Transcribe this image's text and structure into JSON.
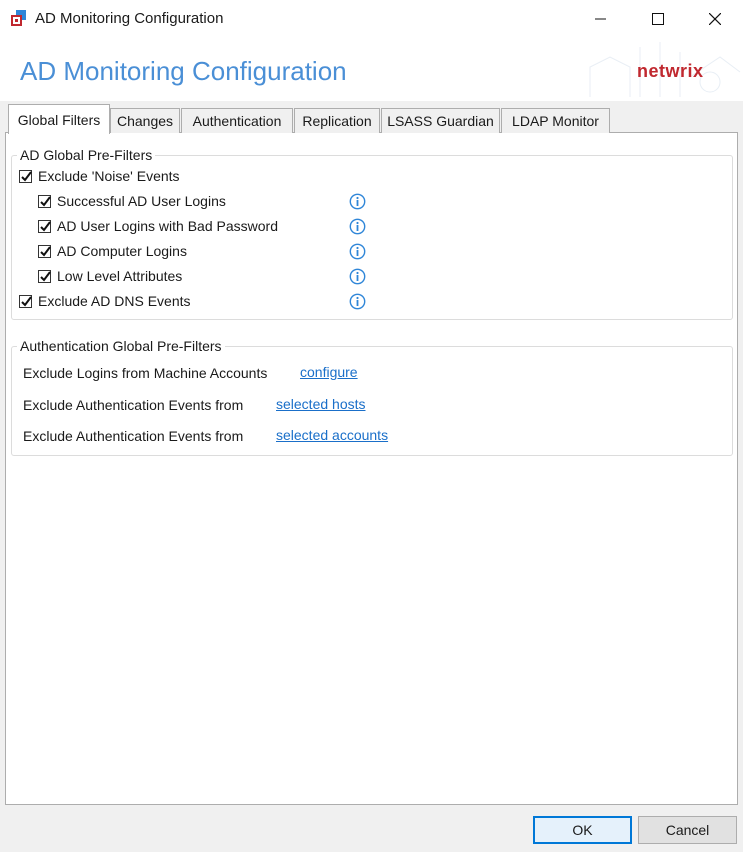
{
  "window": {
    "title": "AD Monitoring Configuration"
  },
  "banner": {
    "title": "AD Monitoring Configuration",
    "brand": "netwrix"
  },
  "tabs": [
    {
      "label": "Global Filters",
      "active": true
    },
    {
      "label": "Changes",
      "active": false
    },
    {
      "label": "Authentication",
      "active": false
    },
    {
      "label": "Replication",
      "active": false
    },
    {
      "label": "LSASS Guardian",
      "active": false
    },
    {
      "label": "LDAP Monitor",
      "active": false
    }
  ],
  "ad_prefilters": {
    "legend": "AD Global Pre-Filters",
    "items": [
      {
        "label": "Exclude 'Noise' Events",
        "checked": true,
        "info": false
      },
      {
        "label": "Successful AD User Logins",
        "checked": true,
        "info": true
      },
      {
        "label": "AD User Logins with Bad Password",
        "checked": true,
        "info": true
      },
      {
        "label": "AD Computer Logins",
        "checked": true,
        "info": true
      },
      {
        "label": "Low Level Attributes",
        "checked": true,
        "info": true
      },
      {
        "label": "Exclude AD DNS Events",
        "checked": true,
        "info": true
      }
    ]
  },
  "auth_prefilters": {
    "legend": "Authentication Global Pre-Filters",
    "rows": [
      {
        "label": "Exclude Logins from Machine Accounts",
        "link": "configure"
      },
      {
        "label": "Exclude Authentication Events from",
        "link": "selected hosts"
      },
      {
        "label": "Exclude Authentication Events from",
        "link": "selected accounts"
      }
    ]
  },
  "buttons": {
    "ok": "OK",
    "cancel": "Cancel"
  },
  "colors": {
    "accent_title": "#4a8fd6",
    "brand": "#c0282f",
    "link": "#1a6fc9",
    "info_icon": "#2f86d8"
  }
}
